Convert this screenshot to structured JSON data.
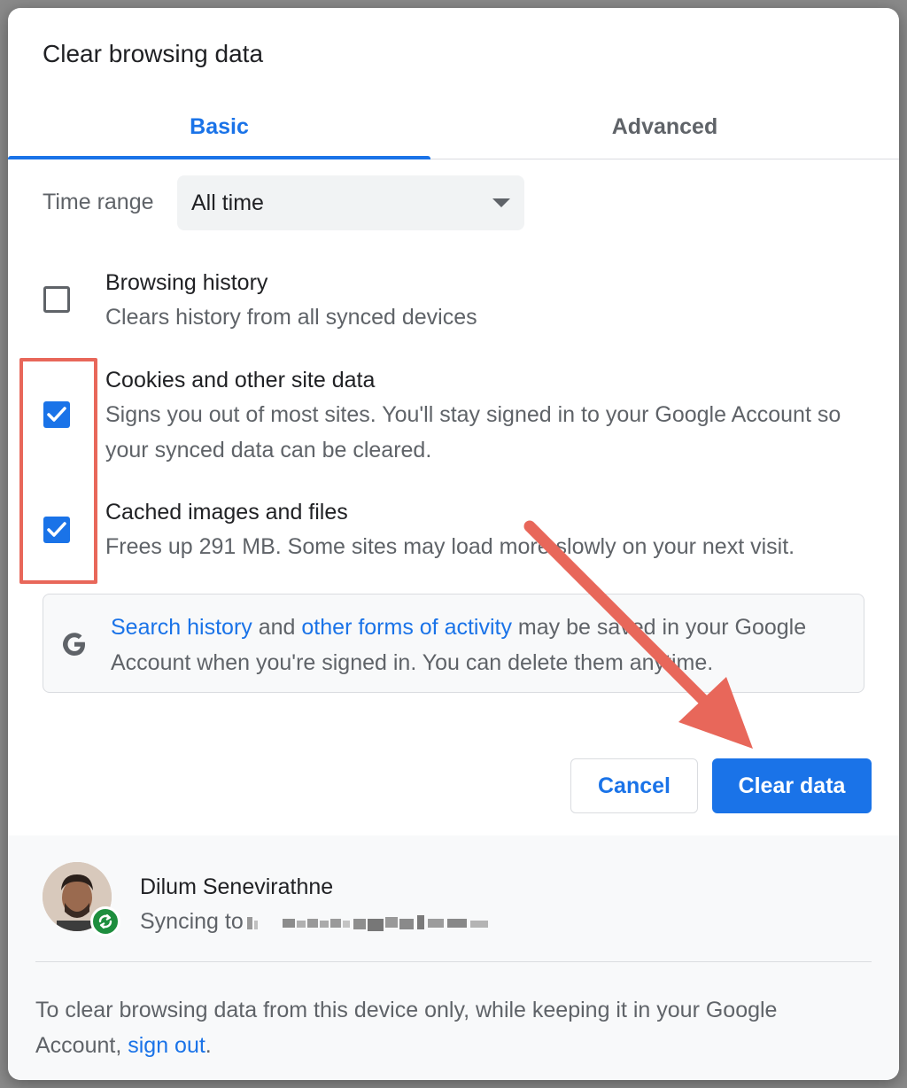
{
  "dialog": {
    "title": "Clear browsing data"
  },
  "tabs": {
    "basic": "Basic",
    "advanced": "Advanced"
  },
  "time_range": {
    "label": "Time range",
    "selected": "All time"
  },
  "options": [
    {
      "title": "Browsing history",
      "desc": "Clears history from all synced devices",
      "checked": false
    },
    {
      "title": "Cookies and other site data",
      "desc": "Signs you out of most sites. You'll stay signed in to your Google Account so your synced data can be cleared.",
      "checked": true
    },
    {
      "title": "Cached images and files",
      "desc": "Frees up 291 MB. Some sites may load more slowly on your next visit.",
      "checked": true
    }
  ],
  "info": {
    "link1": "Search history",
    "text1": " and ",
    "link2": "other forms of activity",
    "text2": " may be saved in your Google Account when you're signed in. You can delete them anytime."
  },
  "buttons": {
    "cancel": "Cancel",
    "clear": "Clear data"
  },
  "account": {
    "name": "Dilum Senevirathne",
    "syncing_prefix": "Syncing to"
  },
  "footer": {
    "text": "To clear browsing data from this device only, while keeping it in your Google Account, ",
    "link": "sign out",
    "suffix": "."
  },
  "colors": {
    "accent": "#1a73e8",
    "annotation": "#e8675a",
    "sync_badge": "#1e8e3e"
  }
}
